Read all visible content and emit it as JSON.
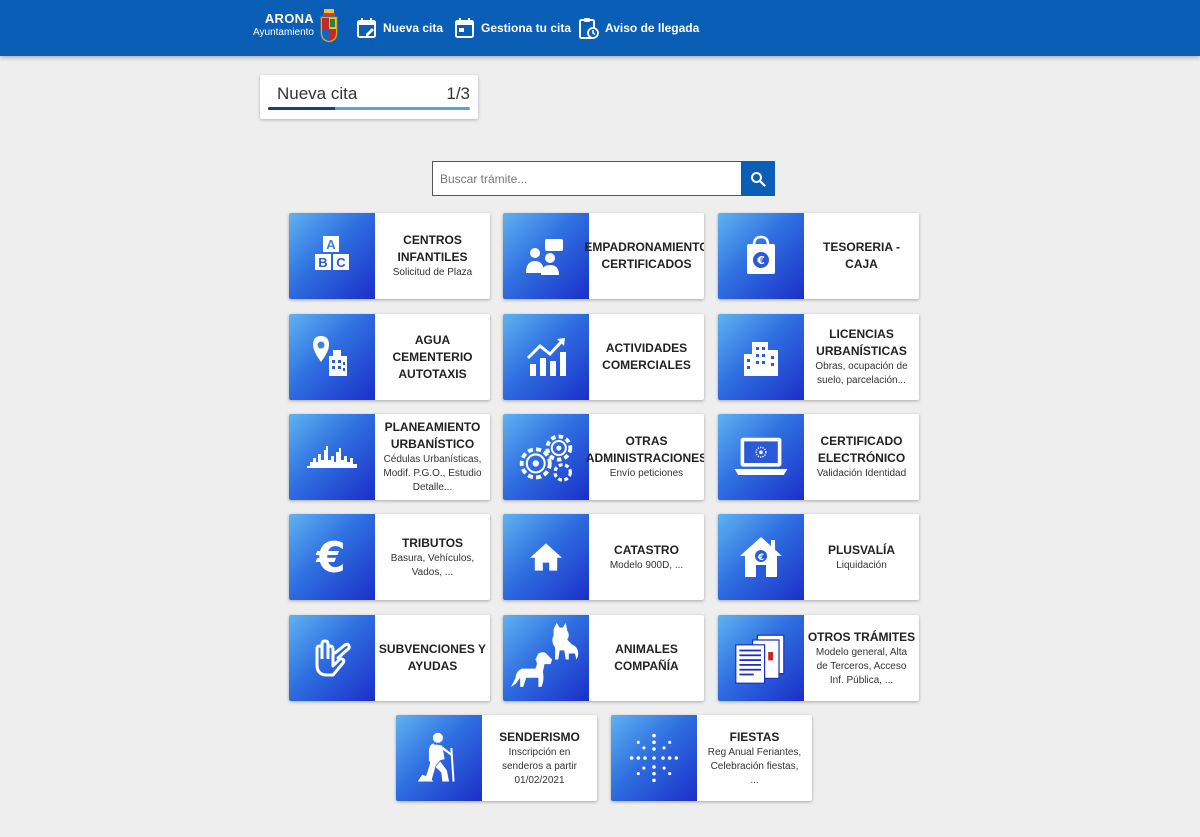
{
  "header": {
    "logo_title": "ARONA",
    "logo_subtitle": "Ayuntamiento",
    "nav": [
      {
        "label": "Nueva cita",
        "icon": "calendar-edit-icon"
      },
      {
        "label": "Gestiona tu cita",
        "icon": "calendar-icon"
      },
      {
        "label": "Aviso de llegada",
        "icon": "clipboard-clock-icon"
      }
    ]
  },
  "step": {
    "title": "Nueva cita",
    "count": "1/3",
    "progress": 0.333
  },
  "search": {
    "placeholder": "Buscar trámite...",
    "value": ""
  },
  "tiles": [
    {
      "title_lines": [
        "CENTROS",
        "INFANTILES"
      ],
      "subtitle_lines": [
        "Solicitud de Plaza"
      ],
      "icon": "abc-blocks-icon"
    },
    {
      "title_lines": [
        "EMPADRONAMIENTO",
        "CERTIFICADOS"
      ],
      "subtitle_lines": [],
      "icon": "people-icon"
    },
    {
      "title_lines": [
        "TESORERIA -",
        "CAJA"
      ],
      "subtitle_lines": [],
      "icon": "euro-bag-icon"
    },
    {
      "title_lines": [
        "AGUA",
        "CEMENTERIO",
        "AUTOTAXIS"
      ],
      "subtitle_lines": [],
      "icon": "map-pin-building-icon"
    },
    {
      "title_lines": [
        "ACTIVIDADES",
        "COMERCIALES"
      ],
      "subtitle_lines": [],
      "icon": "chart-growth-icon"
    },
    {
      "title_lines": [
        "LICENCIAS",
        "URBANÍSTICAS"
      ],
      "subtitle_lines": [
        "Obras, ocupación de",
        "suelo, parcelación..."
      ],
      "icon": "buildings-icon"
    },
    {
      "title_lines": [
        "PLANEAMIENTO",
        "URBANÍSTICO"
      ],
      "subtitle_lines": [
        "Cédulas Urbanísticas,",
        "Modif. P.G.O., Estudio",
        "Detalle..."
      ],
      "icon": "skyline-icon"
    },
    {
      "title_lines": [
        "OTRAS",
        "ADMINISTRACIONES"
      ],
      "subtitle_lines": [
        "Envío peticiones"
      ],
      "icon": "gears-icon"
    },
    {
      "title_lines": [
        "CERTIFICADO",
        "ELECTRÓNICO"
      ],
      "subtitle_lines": [
        "Validación Identidad"
      ],
      "icon": "laptop-certificate-icon"
    },
    {
      "title_lines": [
        "TRIBUTOS"
      ],
      "subtitle_lines": [
        "Basura, Vehículos,",
        "Vados, ..."
      ],
      "icon": "euro-icon"
    },
    {
      "title_lines": [
        "CATASTRO"
      ],
      "subtitle_lines": [
        "Modelo 900D, ..."
      ],
      "icon": "house-icon"
    },
    {
      "title_lines": [
        "PLUSVALÍA"
      ],
      "subtitle_lines": [
        "Liquidación"
      ],
      "icon": "house-euro-icon"
    },
    {
      "title_lines": [
        "SUBVENCIONES Y",
        "AYUDAS"
      ],
      "subtitle_lines": [],
      "icon": "helping-hands-icon"
    },
    {
      "title_lines": [
        "ANIMALES",
        "COMPAÑÍA"
      ],
      "subtitle_lines": [],
      "icon": "cat-dog-icon"
    },
    {
      "title_lines": [
        "OTROS TRÁMITES"
      ],
      "subtitle_lines": [
        "Modelo general, Alta",
        "de Terceros, Acceso",
        "Inf. Pública, ..."
      ],
      "icon": "documents-icon"
    },
    {
      "title_lines": [
        "SENDERISMO"
      ],
      "subtitle_lines": [
        "Inscripción en",
        "senderos a partir",
        "01/02/2021"
      ],
      "icon": "hiker-icon"
    },
    {
      "title_lines": [
        "FIESTAS"
      ],
      "subtitle_lines": [
        "Reg Anual Feriantes,",
        "Celebración fiestas,",
        "..."
      ],
      "icon": "fireworks-icon"
    }
  ]
}
